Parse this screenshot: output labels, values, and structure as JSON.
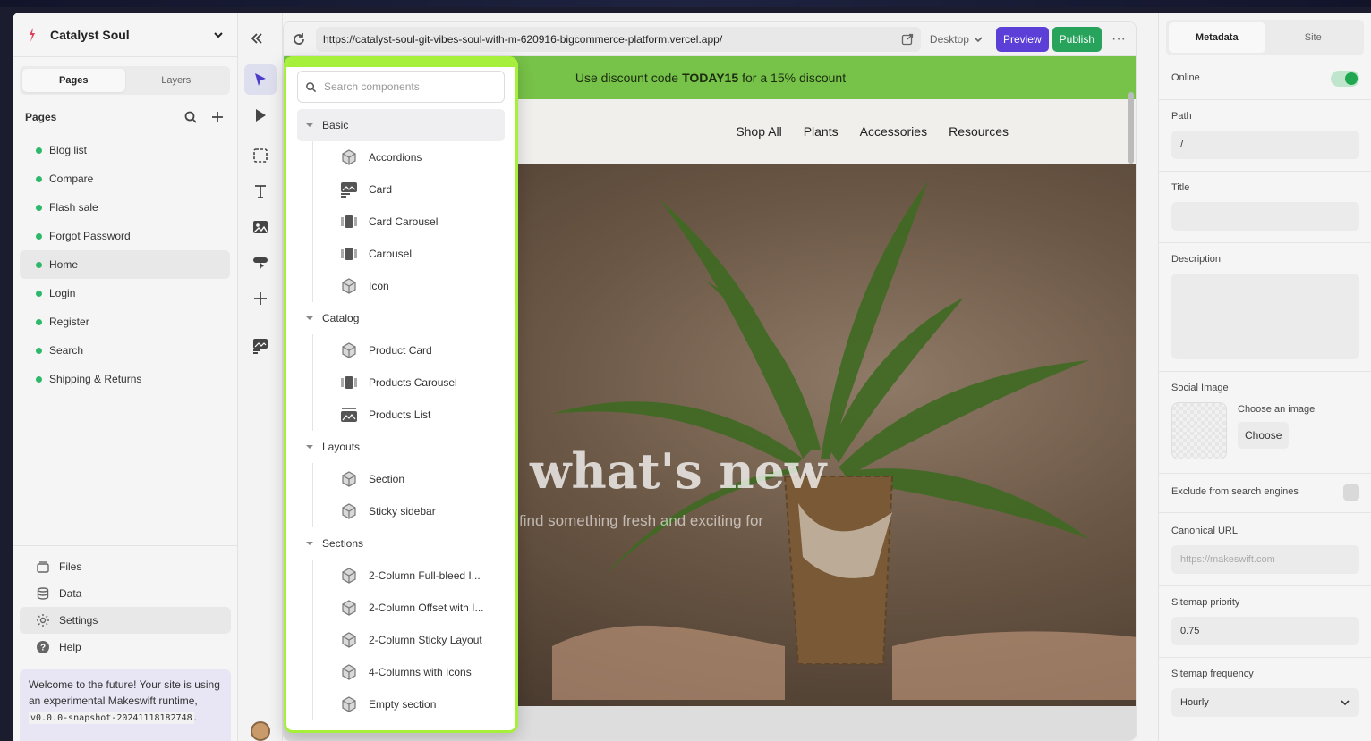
{
  "site": {
    "name": "Catalyst Soul"
  },
  "left": {
    "tabs": [
      "Pages",
      "Layers"
    ],
    "pages_heading": "Pages",
    "pages": [
      "Blog list",
      "Compare",
      "Flash sale",
      "Forgot Password",
      "Home",
      "Login",
      "Register",
      "Search",
      "Shipping & Returns"
    ],
    "active_page": "Home",
    "bottom": [
      "Files",
      "Data",
      "Settings",
      "Help"
    ],
    "welcome_text": "Welcome to the future! Your site is using an experimental Makeswift runtime,",
    "welcome_code": "v0.0.0-snapshot-20241118182748",
    "welcome_suffix": "."
  },
  "browser": {
    "url": "https://catalyst-soul-git-vibes-soul-with-m-620916-bigcommerce-platform.vercel.app/",
    "device": "Desktop",
    "preview": "Preview",
    "publish": "Publish",
    "more": "···"
  },
  "site_preview": {
    "banner_pre": "Use discount code",
    "banner_code": "TODAY15",
    "banner_post": "for a 15% discount",
    "nav": [
      "Shop All",
      "Plants",
      "Accessories",
      "Resources"
    ],
    "hero_title": "what's new",
    "hero_sub": "find something fresh and exciting for"
  },
  "components": {
    "search_placeholder": "Search components",
    "groups": [
      {
        "name": "Basic",
        "items": [
          "Accordions",
          "Card",
          "Card Carousel",
          "Carousel",
          "Icon"
        ]
      },
      {
        "name": "Catalog",
        "items": [
          "Product Card",
          "Products Carousel",
          "Products List"
        ]
      },
      {
        "name": "Layouts",
        "items": [
          "Section",
          "Sticky sidebar"
        ]
      },
      {
        "name": "Sections",
        "items": [
          "2-Column Full-bleed I...",
          "2-Column Offset with I...",
          "2-Column Sticky Layout",
          "4-Columns with Icons",
          "Empty section"
        ]
      }
    ]
  },
  "right": {
    "tabs": [
      "Metadata",
      "Site"
    ],
    "online_label": "Online",
    "path_label": "Path",
    "path_value": "/",
    "title_label": "Title",
    "title_value": "",
    "description_label": "Description",
    "social_label": "Social Image",
    "choose_image": "Choose an image",
    "choose": "Choose",
    "exclude_label": "Exclude from search engines",
    "canonical_label": "Canonical URL",
    "canonical_placeholder": "https://makeswift.com",
    "priority_label": "Sitemap priority",
    "priority_value": "0.75",
    "frequency_label": "Sitemap frequency",
    "frequency_value": "Hourly"
  },
  "colors": {
    "accent": "#5b3fd6",
    "publish": "#27a35c",
    "banner": "#77c248",
    "highlight": "#a6ef3b",
    "status_dot": "#2eb86b"
  }
}
